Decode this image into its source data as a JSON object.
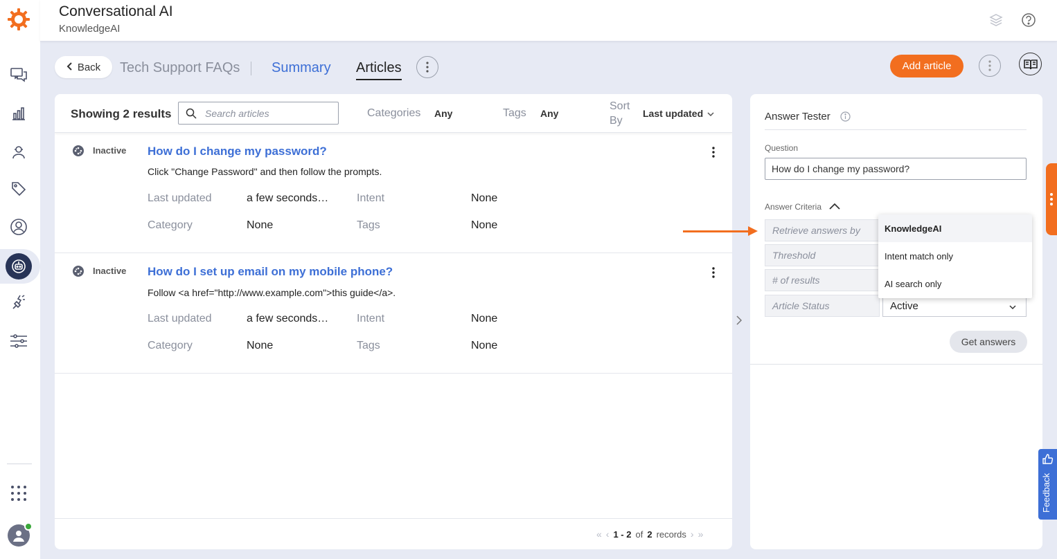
{
  "header": {
    "title": "Conversational AI",
    "subtitle": "KnowledgeAI"
  },
  "nav": {
    "back_label": "Back",
    "kb_name": "Tech Support FAQs",
    "tabs": [
      {
        "label": "Summary"
      },
      {
        "label": "Articles",
        "active": true
      }
    ],
    "add_article_label": "Add article"
  },
  "filters": {
    "results_label": "Showing 2 results",
    "search_placeholder": "Search articles",
    "categories_label": "Categories",
    "categories_value": "Any",
    "tags_label": "Tags",
    "tags_value": "Any",
    "sort_label": "Sort By",
    "sort_value": "Last updated"
  },
  "meta_labels": {
    "last_updated": "Last updated",
    "intent": "Intent",
    "category": "Category",
    "tags": "Tags"
  },
  "articles": [
    {
      "status": "Inactive",
      "title": "How do I change my password?",
      "body": "Click \"Change Password\" and then follow the prompts.",
      "last_updated": "a few seconds…",
      "intent": "None",
      "category": "None",
      "tags": "None"
    },
    {
      "status": "Inactive",
      "title": "How do I set up email on my mobile phone?",
      "body": "Follow <a href=\"http://www.example.com\">this guide</a>.",
      "last_updated": "a few seconds…",
      "intent": "None",
      "category": "None",
      "tags": "None"
    }
  ],
  "pagination": {
    "range": "1 - 2",
    "of_label": "of",
    "total": "2",
    "records_label": "records"
  },
  "answer_tester": {
    "title": "Answer Tester",
    "question_label": "Question",
    "question_value": "How do I change my password?",
    "criteria_label": "Answer Criteria",
    "retrieve_label": "Retrieve answers by",
    "threshold_label": "Threshold",
    "results_count_label": "# of results",
    "article_status_label": "Article Status",
    "article_status_value": "Active",
    "get_answers_label": "Get answers",
    "retrieve_options": [
      {
        "label": "KnowledgeAI",
        "selected": true
      },
      {
        "label": "Intent match only"
      },
      {
        "label": "AI search only"
      }
    ]
  },
  "feedback_label": "Feedback",
  "colors": {
    "accent": "#f26e1f",
    "link": "#3d6fd6",
    "nav_dark": "#283457"
  },
  "icons": [
    "logo-icon",
    "conversations-icon",
    "analytics-icon",
    "agents-icon",
    "tags-icon",
    "user-icon",
    "bot-icon",
    "integrations-icon",
    "settings-sliders-icon",
    "apps-grid-icon",
    "layers-icon",
    "help-icon",
    "kebab-icon",
    "book-icon",
    "search-icon",
    "info-icon",
    "chevron-down-icon",
    "chevron-up-icon",
    "chevron-left-icon",
    "chevron-right-icon",
    "feedback-icon"
  ]
}
